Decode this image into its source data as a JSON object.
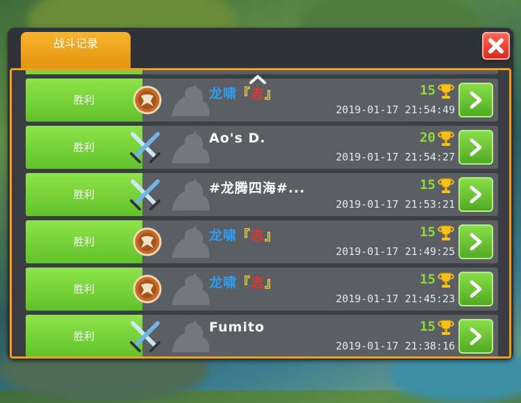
{
  "window": {
    "tab_label": "战斗记录",
    "close_icon": "close-icon"
  },
  "colors": {
    "accent": "#f0a21e",
    "win": "#7fd13d",
    "close": "#e0362d"
  },
  "rows": [
    {
      "result": "胜利",
      "emblem": "shield-icon",
      "name_prefix": "龙啸",
      "name_open": "『",
      "name_mid": "志",
      "name_close": "』",
      "name_plain": "",
      "trophies": "15",
      "time": "2019-01-17 21:54:49"
    },
    {
      "result": "胜利",
      "emblem": "crossed-swords-icon",
      "name_prefix": "",
      "name_open": "",
      "name_mid": "",
      "name_close": "",
      "name_plain": "Ao's D.",
      "trophies": "20",
      "time": "2019-01-17 21:54:27"
    },
    {
      "result": "胜利",
      "emblem": "crossed-swords-icon",
      "name_prefix": "",
      "name_open": "",
      "name_mid": "",
      "name_close": "",
      "name_plain": "#龙腾四海#...",
      "trophies": "15",
      "time": "2019-01-17 21:53:21"
    },
    {
      "result": "胜利",
      "emblem": "shield-icon",
      "name_prefix": "龙啸",
      "name_open": "『",
      "name_mid": "志",
      "name_close": "』",
      "name_plain": "",
      "trophies": "15",
      "time": "2019-01-17 21:49:25"
    },
    {
      "result": "胜利",
      "emblem": "shield-icon",
      "name_prefix": "龙啸",
      "name_open": "『",
      "name_mid": "志",
      "name_close": "』",
      "name_plain": "",
      "trophies": "15",
      "time": "2019-01-17 21:45:23"
    },
    {
      "result": "胜利",
      "emblem": "crossed-swords-icon",
      "name_prefix": "",
      "name_open": "",
      "name_mid": "",
      "name_close": "",
      "name_plain": "Fumito",
      "trophies": "15",
      "time": "2019-01-17 21:38:16"
    }
  ]
}
